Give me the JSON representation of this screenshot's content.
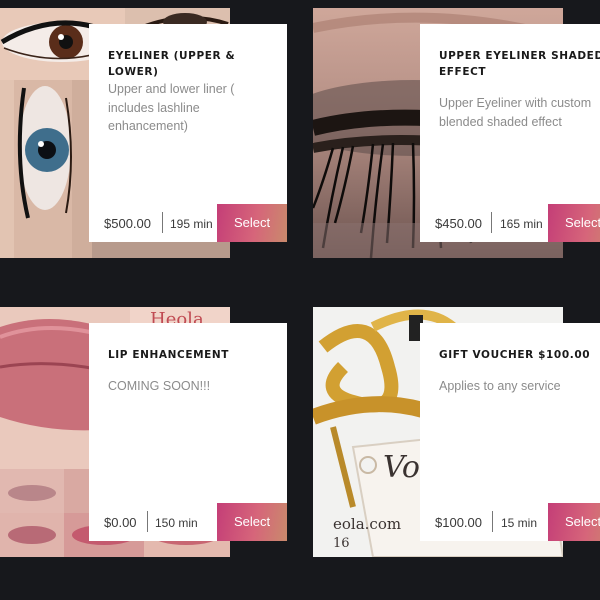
{
  "colors": {
    "background": "#17181c",
    "card": "#ffffff",
    "select_gradient_start": "#c43e77",
    "select_gradient_end": "#c98a6c"
  },
  "services": [
    {
      "title": "EYELINER (UPPER & LOWER)",
      "description": "Upper and lower liner ( includes lashline enhancement)",
      "price": "$500.00",
      "duration": "195 min",
      "select_label": "Select",
      "image": "eyeliner-photo"
    },
    {
      "title": "UPPER EYELINER SHADED EFFECT",
      "description": "Upper Eyeliner with custom blended shaded effect",
      "price": "$450.00",
      "duration": "165 min",
      "select_label": "Select",
      "image": "shaded-eyeliner-photo"
    },
    {
      "title": "LIP ENHANCEMENT",
      "description": "COMING SOON!!!",
      "price": "$0.00",
      "duration": "150 min",
      "select_label": "Select",
      "image": "lips-photo"
    },
    {
      "title": "GIFT VOUCHER $100.00",
      "description": "Applies to any service",
      "price": "$100.00",
      "duration": "15 min",
      "select_label": "Select",
      "image": "gift-voucher-photo"
    }
  ]
}
